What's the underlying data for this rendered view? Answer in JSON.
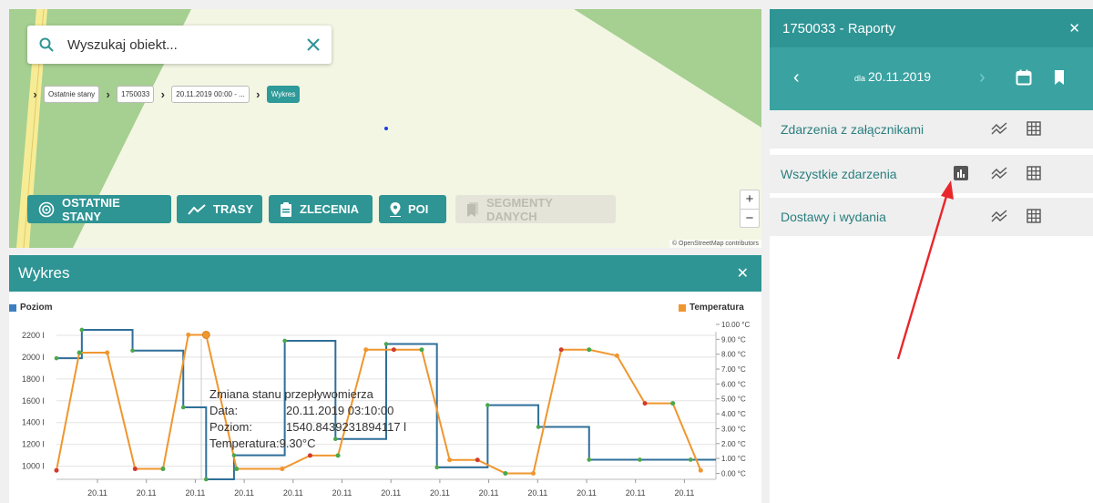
{
  "map": {
    "search_placeholder": "Wyszukaj obiekt...",
    "breadcrumbs": [
      "Ostatnie stany",
      "1750033",
      "20.11.2019 00:00 - ...",
      "Wykres"
    ],
    "buttons": {
      "ostatnie_stany": "OSTATNIE STANY",
      "trasy": "TRASY",
      "zlecenia": "ZLECENIA",
      "poi": "POI",
      "segmenty": "SEGMENTY DANYCH"
    },
    "zoom_in": "+",
    "zoom_out": "−",
    "attribution": "© OpenStreetMap contributors"
  },
  "chart_panel": {
    "title": "Wykres",
    "close": "✕"
  },
  "chart_data": {
    "type": "line",
    "legend": [
      {
        "name": "Poziom",
        "color": "#3c7fc0"
      },
      {
        "name": "Temperatura",
        "color": "#f0962e"
      }
    ],
    "y_left_ticks": [
      "2200 l",
      "2000 l",
      "1800 l",
      "1600 l",
      "1400 l",
      "1200 l",
      "1000 l"
    ],
    "y_left_values": [
      2200,
      2000,
      1800,
      1600,
      1400,
      1200,
      1000
    ],
    "y_right_ticks": [
      "10.00 °C",
      "9.00 °C",
      "8.00 °C",
      "7.00 °C",
      "6.00 °C",
      "5.00 °C",
      "4.00 °C",
      "3.00 °C",
      "2.00 °C",
      "1.00 °C",
      "0.00 °C"
    ],
    "y_right_values": [
      10,
      9,
      8,
      7,
      6,
      5,
      4,
      3,
      2,
      1,
      0
    ],
    "x_ticks": [
      "20.11",
      "20.11",
      "20.11",
      "20.11",
      "20.11",
      "20.11",
      "20.11",
      "20.11",
      "20.11",
      "20.11",
      "20.11",
      "20.11",
      "20.11"
    ],
    "series": [
      {
        "name": "Poziom",
        "color": "#2f6f9a",
        "step": true,
        "x": [
          0,
          0.5,
          1.5,
          2.5,
          2.95,
          3.5,
          4.5,
          5.5,
          6.5,
          7.5,
          8.5,
          9.5,
          10.5,
          11.5,
          12.5
        ],
        "values": [
          1990,
          2250,
          2060,
          1540,
          880,
          1100,
          2150,
          1250,
          2120,
          990,
          1560,
          1360,
          1060,
          1060,
          1060
        ]
      },
      {
        "name": "Temperatura",
        "color": "#f0962e",
        "x": [
          0,
          0.45,
          1.0,
          1.55,
          2.1,
          2.6,
          2.95,
          3.55,
          4.45,
          5.0,
          5.55,
          6.1,
          6.65,
          7.2,
          7.75,
          8.3,
          8.85,
          9.4,
          9.95,
          10.5,
          11.05,
          11.6,
          12.15,
          12.7
        ],
        "values": [
          0.2,
          8.1,
          8.1,
          0.3,
          0.3,
          9.3,
          9.3,
          0.3,
          0.3,
          1.2,
          1.2,
          8.3,
          8.3,
          8.3,
          0.9,
          0.9,
          0.0,
          0.0,
          8.3,
          8.3,
          7.9,
          4.7,
          4.7,
          0.2
        ]
      }
    ],
    "y_left_range": [
      880,
      2300
    ],
    "y_right_range": [
      -0.4,
      10.0
    ]
  },
  "tooltip": {
    "title": "Zmiana stanu przepływomierza",
    "data_label": "Data:",
    "data_value": "20.11.2019 03:10:00",
    "poziom_label": "Poziom:",
    "poziom_value": "1540.8439231894117 l",
    "temp_label": "Temperatura:",
    "temp_value": "9.30°C"
  },
  "right_panel": {
    "title": "1750033 - Raporty",
    "close": "✕",
    "date_prefix": "dla",
    "date": "20.11.2019",
    "rows": [
      "Zdarzenia z załącznikami",
      "Wszystkie zdarzenia",
      "Dostawy i wydania"
    ]
  },
  "colors": {
    "teal": "#2e9494",
    "teal_light": "#3aa3a2",
    "annotation_arrow": "#e8262b"
  }
}
